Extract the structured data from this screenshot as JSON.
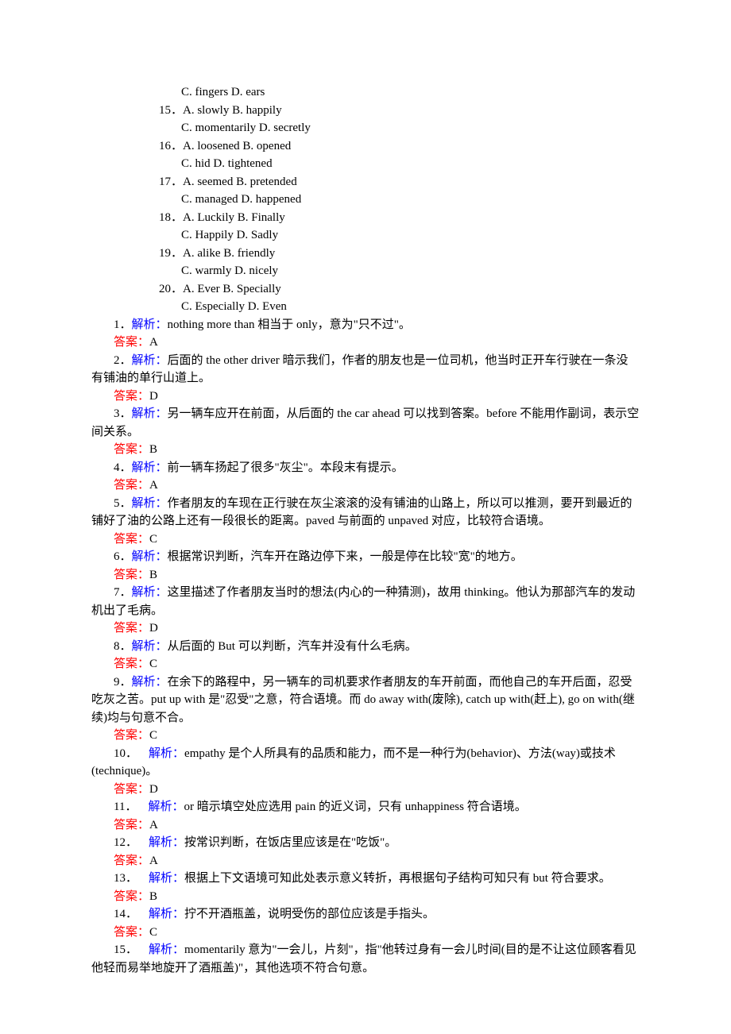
{
  "choices": [
    {
      "sub": "C. fingers    D. ears"
    },
    {
      "num": "15．",
      "main": "A. slowly    B. happily",
      "sub": "C. momentarily    D. secretly"
    },
    {
      "num": "16．",
      "main": "A. loosened    B. opened",
      "sub": "C. hid    D. tightened"
    },
    {
      "num": "17．",
      "main": "A. seemed    B. pretended",
      "sub": "C. managed    D. happened"
    },
    {
      "num": "18．",
      "main": "A. Luckily    B. Finally",
      "sub": "C. Happily    D. Sadly"
    },
    {
      "num": "19．",
      "main": "A. alike    B. friendly",
      "sub": "C. warmly    D. nicely"
    },
    {
      "num": "20．",
      "main": "A. Ever    B. Specially",
      "sub": "C. Especially    D. Even"
    }
  ],
  "explanations": [
    {
      "num": "1．",
      "lbl_exp": "解析：",
      "text": "nothing more than 相当于 only，意为\"只不过\"。",
      "lbl_ans": "答案：",
      "ans": "A"
    },
    {
      "num": "2．",
      "lbl_exp": "解析：",
      "text": "后面的 the other driver 暗示我们，作者的朋友也是一位司机，他当时正开车行驶在一条没有铺油的单行山道上。",
      "lbl_ans": "答案：",
      "ans": "D",
      "wrap": true
    },
    {
      "num": "3．",
      "lbl_exp": "解析：",
      "text": "另一辆车应开在前面，从后面的 the car ahead 可以找到答案。before 不能用作副词，表示空间关系。",
      "lbl_ans": "答案：",
      "ans": "B",
      "wrap": true
    },
    {
      "num": "4．",
      "lbl_exp": "解析：",
      "text": "前一辆车扬起了很多\"灰尘\"。本段末有提示。",
      "lbl_ans": "答案：",
      "ans": "A"
    },
    {
      "num": "5．",
      "lbl_exp": "解析：",
      "text": "作者朋友的车现在正行驶在灰尘滚滚的没有铺油的山路上，所以可以推测，要开到最近的铺好了油的公路上还有一段很长的距离。paved 与前面的 unpaved 对应，比较符合语境。",
      "lbl_ans": "答案：",
      "ans": "C",
      "wrap": true
    },
    {
      "num": "6．",
      "lbl_exp": "解析：",
      "text": "根据常识判断，汽车开在路边停下来，一般是停在比较\"宽\"的地方。",
      "lbl_ans": "答案：",
      "ans": "B"
    },
    {
      "num": "7．",
      "lbl_exp": "解析：",
      "text": "这里描述了作者朋友当时的想法(内心的一种猜测)，故用 thinking。他认为那部汽车的发动机出了毛病。",
      "lbl_ans": "答案：",
      "ans": "D",
      "wrap": true
    },
    {
      "num": "8．",
      "lbl_exp": "解析：",
      "text": "从后面的 But 可以判断，汽车并没有什么毛病。",
      "lbl_ans": "答案：",
      "ans": "C"
    },
    {
      "num": "9．",
      "lbl_exp": "解析：",
      "text": "在余下的路程中，另一辆车的司机要求作者朋友的车开前面，而他自己的车开后面，忍受吃灰之苦。put up with 是\"忍受\"之意，符合语境。而 do away with(废除), catch up with(赶上), go on with(继续)均与句意不合。",
      "lbl_ans": "答案：",
      "ans": "C",
      "wrap": true
    },
    {
      "num": "10．",
      "lbl_exp": "解析：",
      "text": "empathy 是个人所具有的品质和能力，而不是一种行为(behavior)、方法(way)或技术(technique)。",
      "lbl_ans": "答案：",
      "ans": "D",
      "wrap": true,
      "numspace": true
    },
    {
      "num": "11．",
      "lbl_exp": "解析：",
      "text": "or 暗示填空处应选用 pain 的近义词，只有 unhappiness 符合语境。",
      "lbl_ans": "答案：",
      "ans": "A",
      "numspace": true
    },
    {
      "num": "12．",
      "lbl_exp": "解析：",
      "text": "按常识判断，在饭店里应该是在\"吃饭\"。",
      "lbl_ans": "答案：",
      "ans": "A",
      "numspace": true
    },
    {
      "num": "13．",
      "lbl_exp": "解析：",
      "text": "根据上下文语境可知此处表示意义转折，再根据句子结构可知只有 but 符合要求。",
      "lbl_ans": "答案：",
      "ans": "B",
      "wrap": true,
      "numspace": true
    },
    {
      "num": "14．",
      "lbl_exp": "解析：",
      "text": "拧不开酒瓶盖，说明受伤的部位应该是手指头。",
      "lbl_ans": "答案：",
      "ans": "C",
      "numspace": true
    },
    {
      "num": "15．",
      "lbl_exp": "解析：",
      "text": "momentarily 意为\"一会儿，片刻\"，指\"他转过身有一会儿时间(目的是不让这位顾客看见他轻而易举地旋开了酒瓶盖)\"，其他选项不符合句意。",
      "wrap": true,
      "numspace": true
    }
  ]
}
